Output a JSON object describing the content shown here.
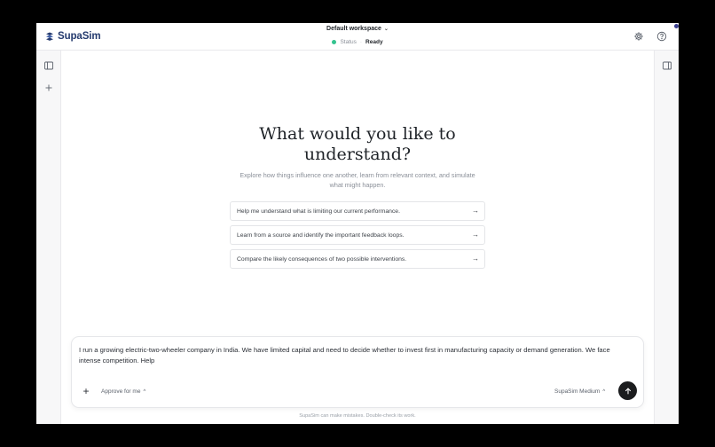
{
  "app": {
    "brand": "SupaSim",
    "brand_color": "#243a6e"
  },
  "header": {
    "workspace": "Default workspace",
    "status_label": "Status",
    "status_separator": "·",
    "status_value": "Ready",
    "status_color": "#34c38f",
    "icons": [
      "settings-icon",
      "help-icon"
    ]
  },
  "left_rail": {
    "icons": [
      "sidebar-toggle-icon",
      "plus-icon"
    ]
  },
  "right_rail": {
    "icons": [
      "right-panel-toggle-icon"
    ]
  },
  "hero": {
    "title_line1": "What would you like to",
    "title_line2": "understand?",
    "subtitle_line1": "Explore how things influence one another, learn from relevant context, and simulate",
    "subtitle_line2": "what might happen."
  },
  "suggestions": [
    {
      "label": "Help me understand what is limiting our current performance.",
      "arrow": "→"
    },
    {
      "label": "Learn from a source and identify the important feedback loops.",
      "arrow": "→"
    },
    {
      "label": "Compare the likely consequences of two possible interventions.",
      "arrow": "→"
    }
  ],
  "composer": {
    "text": "I run a growing electric-two-wheeler company in India. We have limited capital and need to decide whether to invest first in manufacturing capacity or demand generation. We face intense competition. Help",
    "plus": "+",
    "approve_label": "Approve for me",
    "approve_caret": "^",
    "model_label": "SupaSim  Medium",
    "model_caret": "^",
    "send_icon": "arrow-up-icon"
  },
  "disclaimer": "SupaSim can make mistakes. Double-check its work."
}
